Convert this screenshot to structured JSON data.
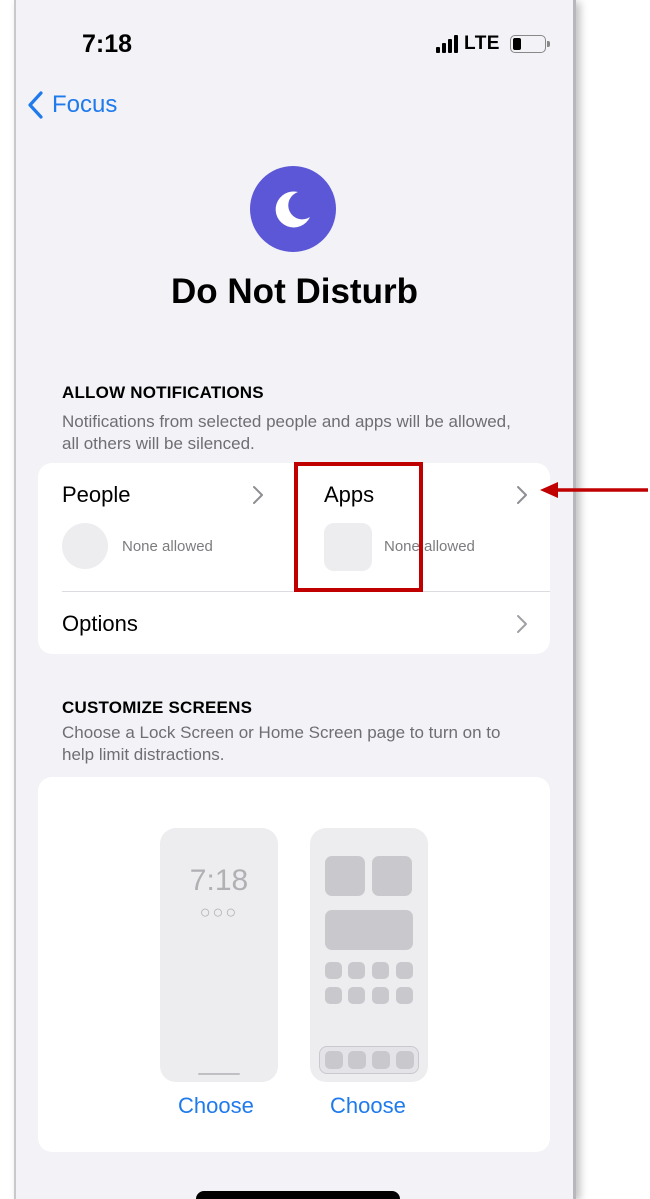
{
  "status_bar": {
    "time": "7:18",
    "network": "LTE"
  },
  "nav": {
    "back_label": "Focus"
  },
  "header": {
    "title": "Do Not Disturb",
    "icon": "moon-icon",
    "icon_color": "#5b57d6"
  },
  "allow_notifications": {
    "heading": "ALLOW NOTIFICATIONS",
    "description": "Notifications from selected people and apps will be allowed, all others will be silenced.",
    "people": {
      "label": "People",
      "status": "None allowed"
    },
    "apps": {
      "label": "Apps",
      "status": "None allowed"
    },
    "options": {
      "label": "Options"
    }
  },
  "customize_screens": {
    "heading": "CUSTOMIZE SCREENS",
    "description": "Choose a Lock Screen or Home Screen page to turn on to help limit distractions.",
    "lock_screen": {
      "time": "7:18",
      "dots": "○○○",
      "action": "Choose"
    },
    "home_screen": {
      "action": "Choose"
    }
  },
  "annotation": {
    "highlight_color": "#c00000"
  },
  "colors": {
    "accent": "#1f7aec",
    "background": "#f2f2f7"
  }
}
